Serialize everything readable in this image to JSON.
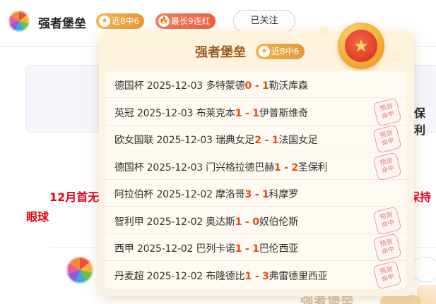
{
  "header": {
    "expert_name": "强者堡垒",
    "streak_badge": "近8中6",
    "longest_badge": "最长9连红",
    "follow_button": "已关注"
  },
  "background": {
    "card_text": "保利",
    "red_headline_1": "12月首无",
    "red_headline_2": "眼球",
    "red_headline_3": "保持",
    "ghost_title": "强者堡垒"
  },
  "popup": {
    "title": "强者堡垒",
    "badge": "近8中6",
    "stamp_line1": "预测",
    "stamp_line2": "命中",
    "matches": [
      {
        "league": "德国杯",
        "date": "2025-12-03",
        "home": "多特蒙德",
        "home_score": "0",
        "sep": " - ",
        "away_score": "1",
        "away": "勒沃库森",
        "hit": false
      },
      {
        "league": "英冠",
        "date": "2025-12-03",
        "home": "布莱克本",
        "home_score": "1",
        "sep": " - ",
        "away_score": "1",
        "away": "伊普斯维奇",
        "hit": true
      },
      {
        "league": "欧女国联",
        "date": "2025-12-03",
        "home": "瑞典女足",
        "home_score": "2",
        "sep": " - ",
        "away_score": "1",
        "away": "法国女足",
        "hit": true
      },
      {
        "league": "德国杯",
        "date": "2025-12-03",
        "home": "门兴格拉德巴赫",
        "home_score": "1",
        "sep": " - ",
        "away_score": "2",
        "away": "圣保利",
        "hit": true
      },
      {
        "league": "阿拉伯杯",
        "date": "2025-12-02",
        "home": "摩洛哥",
        "home_score": "3",
        "sep": " - ",
        "away_score": "1",
        "away": "科摩罗",
        "hit": false
      },
      {
        "league": "智利甲",
        "date": "2025-12-02",
        "home": "奥达斯",
        "home_score": "1",
        "sep": " - ",
        "away_score": "0",
        "away": "奴伯伦斯",
        "hit": true
      },
      {
        "league": "西甲",
        "date": "2025-12-02",
        "home": "巴列卡诺",
        "home_score": "1",
        "sep": " - ",
        "away_score": "1",
        "away": "巴伦西亚",
        "hit": true
      },
      {
        "league": "丹麦超",
        "date": "2025-12-02",
        "home": "布隆德比",
        "home_score": "1",
        "sep": " - ",
        "away_score": "3",
        "away": "弗雷德里西亚",
        "hit": true
      }
    ]
  },
  "icons": {
    "badge_star": "★",
    "badge_fire": "🔥",
    "medal_star": "★",
    "sparkle": "✦"
  }
}
